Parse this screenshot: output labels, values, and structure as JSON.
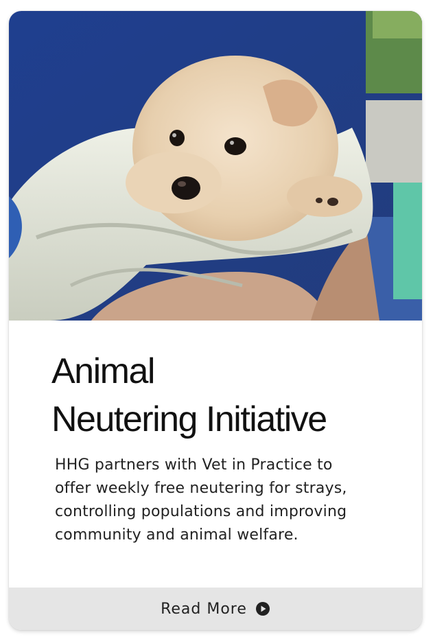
{
  "card": {
    "title_lines": [
      "Animal",
      "Neutering Initiative"
    ],
    "description_lines": [
      "HHG partners with Vet in Practice to",
      "offer weekly free neutering for strays,",
      "controlling populations and improving",
      "community and animal welfare."
    ],
    "read_more_label": "Read More",
    "read_more_icon": "play-circle-icon"
  },
  "colors": {
    "footer_bg": "#e5e5e5",
    "title_text": "#111111",
    "body_text": "#222222"
  }
}
